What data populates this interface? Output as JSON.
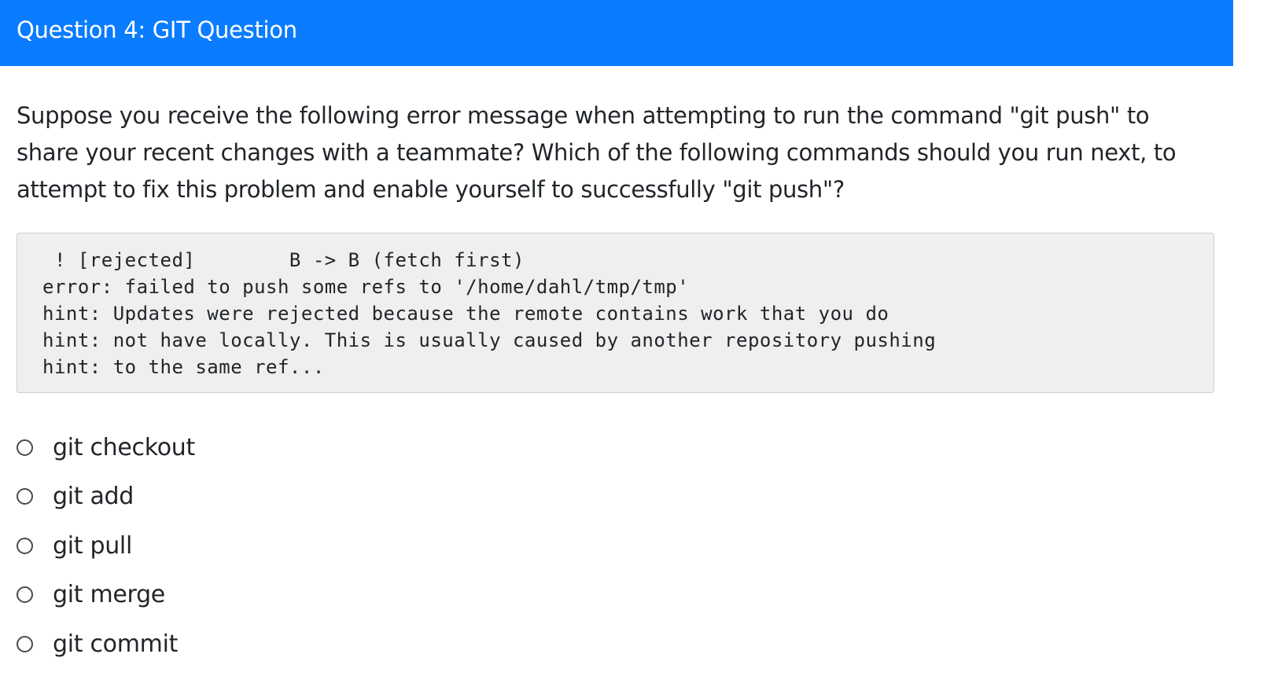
{
  "header": {
    "title": "Question 4: GIT Question"
  },
  "question": {
    "prompt": "Suppose you receive the following error message when attempting to run the command \"git push\" to share your recent changes with a teammate? Which of the following commands should you run next, to attempt to fix this problem and enable yourself to successfully \"git push\"?"
  },
  "code": {
    "lines": [
      " ! [rejected]        B -> B (fetch first)",
      "error: failed to push some refs to '/home/dahl/tmp/tmp'",
      "hint: Updates were rejected because the remote contains work that you do",
      "hint: not have locally. This is usually caused by another repository pushing",
      "hint: to the same ref..."
    ]
  },
  "options": [
    {
      "label": "git checkout"
    },
    {
      "label": "git add"
    },
    {
      "label": "git pull"
    },
    {
      "label": "git merge"
    },
    {
      "label": "git commit"
    }
  ]
}
